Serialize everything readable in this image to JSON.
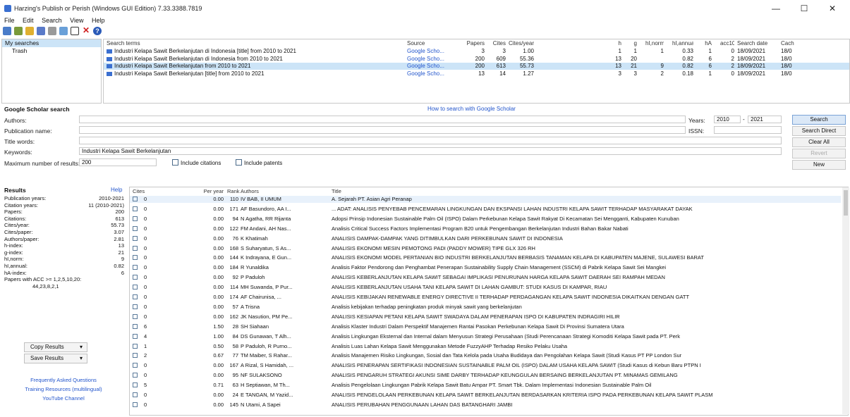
{
  "window": {
    "title": "Harzing's Publish or Perish (Windows GUI Edition) 7.33.3388.7819",
    "minimize": "—",
    "maximize": "☐",
    "close": "✕"
  },
  "menu": [
    "File",
    "Edit",
    "Search",
    "View",
    "Help"
  ],
  "tree": [
    "My searches",
    "Trash"
  ],
  "query_headers": [
    "Search terms",
    "Source",
    "Papers",
    "Cites",
    "Cites/year",
    "h",
    "g",
    "hI,norm",
    "hI,annual",
    "hA",
    "acc10",
    "Search date",
    "Cach"
  ],
  "queries": [
    [
      "Industri Kelapa Sawit Berkelanjutan di Indonesia [title] from 2010 to 2021",
      "Google Scho...",
      "3",
      "3",
      "1.00",
      "1",
      "1",
      "1",
      "0.33",
      "1",
      "0",
      "18/09/2021",
      "18/0"
    ],
    [
      "Industri Kelapa Sawit Berkelanjutan di Indonesia from 2010 to 2021",
      "Google Scho...",
      "200",
      "609",
      "55.36",
      "13",
      "20",
      "",
      "0.82",
      "6",
      "2",
      "18/09/2021",
      "18/0"
    ],
    [
      "Industri Kelapa Sawit Berkelanjutan from 2010 to 2021",
      "Google Scho...",
      "200",
      "613",
      "55.73",
      "13",
      "21",
      "9",
      "0.82",
      "6",
      "2",
      "18/09/2021",
      "18/0"
    ],
    [
      "Industri Kelapa Sawit Berkelanjutan [title] from 2010 to 2021",
      "Google Scho...",
      "13",
      "14",
      "1.27",
      "3",
      "3",
      "2",
      "0.18",
      "1",
      "0",
      "18/09/2021",
      "18/0"
    ]
  ],
  "gs": {
    "title": "Google Scholar search",
    "help_link": "How to search with Google Scholar",
    "authors_label": "Authors:",
    "years_label": "Years:",
    "year_from": "2010",
    "year_to": "2021",
    "pub_label": "Publication name:",
    "issn_label": "ISSN:",
    "title_label": "Title words:",
    "keywords_label": "Keywords:",
    "keywords_value": "Industri Kelapa Sawit Berkelanjutan",
    "max_label": "Maximum number of results:",
    "max_value": "200",
    "include_citations": "Include citations",
    "include_patents": "Include patents",
    "btn_search": "Search",
    "btn_direct": "Search Direct",
    "btn_clear": "Clear All",
    "btn_revert": "Revert",
    "btn_new": "New"
  },
  "results": {
    "title": "Results",
    "help": "Help",
    "metrics": [
      [
        "Publication years:",
        "2010-2021"
      ],
      [
        "Citation years:",
        "11 (2010-2021)"
      ],
      [
        "Papers:",
        "200"
      ],
      [
        "Citations:",
        "613"
      ],
      [
        "Cites/year:",
        "55.73"
      ],
      [
        "Cites/paper:",
        "3.07"
      ],
      [
        "Authors/paper:",
        "2.81"
      ],
      [
        "h-index:",
        "13"
      ],
      [
        "g-index:",
        "21"
      ],
      [
        "hI,norm:",
        "9"
      ],
      [
        "hI,annual:",
        "0.82"
      ],
      [
        "hA-index:",
        "6"
      ],
      [
        "Papers with ACC >= 1,2,5,10,20:",
        ""
      ],
      [
        "",
        "44,23,8,2,1"
      ]
    ],
    "copy_btn": "Copy Results",
    "save_btn": "Save Results",
    "links": [
      "Frequently Asked Questions",
      "Training Resources (multilingual)",
      "YouTube Channel"
    ]
  },
  "result_headers": [
    "Cites",
    "Per year",
    "Rank",
    "Authors",
    "Title"
  ],
  "rows": [
    [
      "0",
      "0.00",
      "110",
      "IV BAB, II UMUM",
      "A. Sejarah PT. Asian Agri Peranap"
    ],
    [
      "0",
      "0.00",
      "171",
      "AF Basundoro, AA I...",
      "... ADAT: ANALISIS PENYEBAB PENCEMARAN LINGKUNGAN DAN EKSPANSI LAHAN INDUSTRI KELAPA SAWIT TERHADAP MASYARAKAT DAYAK"
    ],
    [
      "0",
      "0.00",
      "94",
      "N Agatha, RR Rijanta",
      "Adopsi Prinsip Indonesian Sustainable Palm Oil (ISPO) Dalam Perkebunan Kelapa Sawit Rakyat Di Kecamatan Sei Mengganti, Kabupaten Kunuban"
    ],
    [
      "0",
      "0.00",
      "122",
      "FM Andani, AH Nas...",
      "Analisis Critical Success Factors Implementasi Program B20 untuk Pengembangan Berkelanjutan Industri Bahan Bakar Nabati"
    ],
    [
      "0",
      "0.00",
      "76",
      "K Khatimah",
      "ANALISIS DAMPAK-DAMPAK YANG DITIMBULKAN DARI PERKEBUNAN SAWIT DI INDONESIA"
    ],
    [
      "0",
      "0.00",
      "168",
      "S Suharyatun, S As...",
      "ANALISIS EKONOMI MESIN PEMOTONG PADI (PADDY MOWER) TIPE GLX 326 RH"
    ],
    [
      "0",
      "0.00",
      "144",
      "K Indrayana, E Gun...",
      "ANALISIS EKONOMI MODEL PERTANIAN BIO INDUSTRI BERKELANJUTAN BERBASIS TANAMAN KELAPA DI KABUPATEN MAJENE, SULAWESI BARAT"
    ],
    [
      "0",
      "0.00",
      "184",
      "R Yunaldika",
      "Analisis Faktor Pendorong dan Penghambat Penerapan Sustainability Supply Chain Management (SSCM) di Pabrik Kelapa Sawit Sei Mangkei"
    ],
    [
      "0",
      "0.00",
      "92",
      "P Paduloh",
      "ANALISIS KEBERLANJUTAN KELAPA SAWIT SEBAGAI IMPLIKASI PENURUNAN HARGA KELAPA SAWIT DAERAH SEI RAMPAH MEDAN"
    ],
    [
      "0",
      "0.00",
      "114",
      "MH Suwanda, P Pur...",
      "ANALISIS KEBERLANJUTAN USAHA TANI KELAPA SAWIT DI LAHAN GAMBUT: STUDI KASUS DI KAMPAR, RIAU"
    ],
    [
      "0",
      "0.00",
      "174",
      "AF Chairunisa, ...",
      "ANALISIS KEBIJAKAN RENEWABLE ENERGY DIRECTIVE II TERHADAP PERDAGANGAN KELAPA SAWIT INDONESIA DIKAITKAN DENGAN GATT"
    ],
    [
      "0",
      "0.00",
      "57",
      "A Trisna",
      "Analisis kebijakan terhadap peningkatan produk minyak sawit yang berkelanjutan"
    ],
    [
      "0",
      "0.00",
      "162",
      "JK Nasution, PM Pe...",
      "ANALISIS KESIAPAN PETANI KELAPA SAWIT SWADAYA DALAM PENERAPAN ISPO DI KABUPATEN INDRAGIRI HILIR"
    ],
    [
      "6",
      "1.50",
      "28",
      "SH Siahaan",
      "Analisis Klaster Industri Dalam Perspektif Manajemen Rantai Pasokan Perkebunan Kelapa Sawit Di Provinsi Sumatera Utara"
    ],
    [
      "4",
      "1.00",
      "84",
      "DS Gunawan, T Alh...",
      "Analisis Lingkungan Eksternal dan Internal dalam Menyusun Strategi Perusahaan (Studi Perencanaan Strategi Komoditi Kelapa Sawit pada PT. Perk"
    ],
    [
      "1",
      "0.50",
      "58",
      "P Paduloh, R Purno...",
      "Analisis Luas Lahan Kelapa Sawit Menggunakan Metode FuzzyAHP Terhadap Resiko Pelaku Usaha"
    ],
    [
      "2",
      "0.67",
      "77",
      "TM Maiber, S Rahar...",
      "Analisis Manajemen Risiko Lingkungan, Sosial dan Tata Kelola pada Usaha Budidaya dan Pengolahan Kelapa Sawit (Studi Kasus PT PP London Sur"
    ],
    [
      "0",
      "0.00",
      "167",
      "A Rizal, S Hamidah, ...",
      "ANALISIS PENERAPAN SERTIFIKASI INDONESIAN SUSTAINABLE PALM OIL (ISPO) DALAM USAHA KELAPA SAWIT (Studi Kasus di Kebun Baru PTPN I"
    ],
    [
      "0",
      "0.00",
      "95",
      "NF SULAKSONO",
      "ANALISIS PENGARUH STRATEGI AKUNSI SIME DARBY TERHADAP KEUNGGULAN BERSAING BERKELANJUTAN PT. MINAMAS GEMILANG"
    ],
    [
      "5",
      "0.71",
      "63",
      "H Septiawan, M Th...",
      "Analisis Pengelolaan Lingkungan Pabrik Kelapa Sawit Batu Ampar PT. Smart Tbk. Dalam Implementasi Indonesian Sustainable Palm Oil"
    ],
    [
      "0",
      "0.00",
      "24",
      "E TANGAN, M Yazid...",
      "ANALISIS PENGELOLAAN PERKEBUNAN KELAPA SAWIT BERKELANJUTAN BERDASARKAN KRITERIA ISPO PADA PERKEBUNAN KELAPA SAWIT PLASM"
    ],
    [
      "0",
      "0.00",
      "145",
      "N Utami, A Sapei",
      "ANALISIS PERUBAHAN PENGGUNAAN LAHAN DAS BATANGHARI JAMBI"
    ]
  ]
}
